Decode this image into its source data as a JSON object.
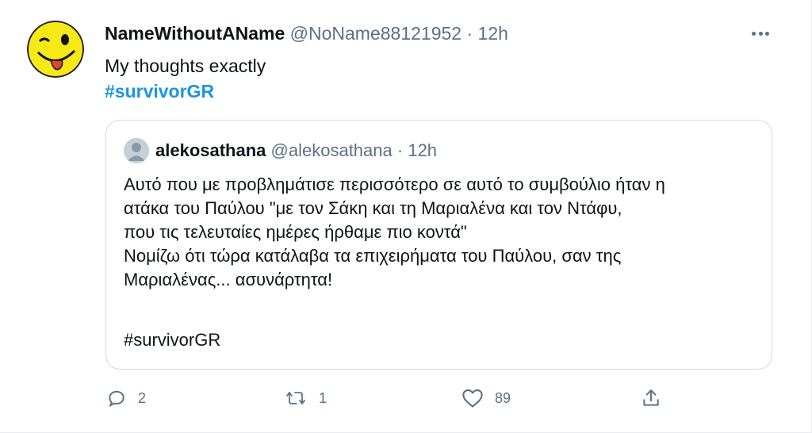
{
  "tweet": {
    "display_name": "NameWithoutAName",
    "handle": "@NoName88121952",
    "separator": "·",
    "time": "12h",
    "text": "My thoughts exactly",
    "hashtag": "#survivorGR",
    "avatar_icon": "winking-smiley-tongue-icon",
    "more_icon": "more-options-icon"
  },
  "quoted_tweet": {
    "display_name": "alekosathana",
    "handle": "@alekosathana",
    "separator": "·",
    "time": "12h",
    "lines": [
      "Αυτό που με προβλημάτισε περισσότερο σε αυτό το συμβούλιο ήταν η",
      "ατάκα του Παύλου \"με τον Σάκη και τη Μαριαλένα και τον Ντάφυ,",
      "που τις τελευταίες ημέρες ήρθαμε πιο κοντά\"",
      "Νομίζω ότι τώρα κατάλαβα τα επιχειρήματα του Παύλου, σαν της",
      "Μαριαλένας... ασυνάρτητα!"
    ],
    "hashtag": "#survivorGR",
    "avatar_icon": "default-profile-icon"
  },
  "actions": {
    "reply_count": "2",
    "retweet_count": "1",
    "like_count": "89",
    "share_count": ""
  },
  "colors": {
    "hashtag": "#1b95e0",
    "secondary_text": "#5b7083",
    "primary_text": "#0f1419",
    "border": "#cfd9de",
    "avatar_yellow": "#f7e818"
  }
}
